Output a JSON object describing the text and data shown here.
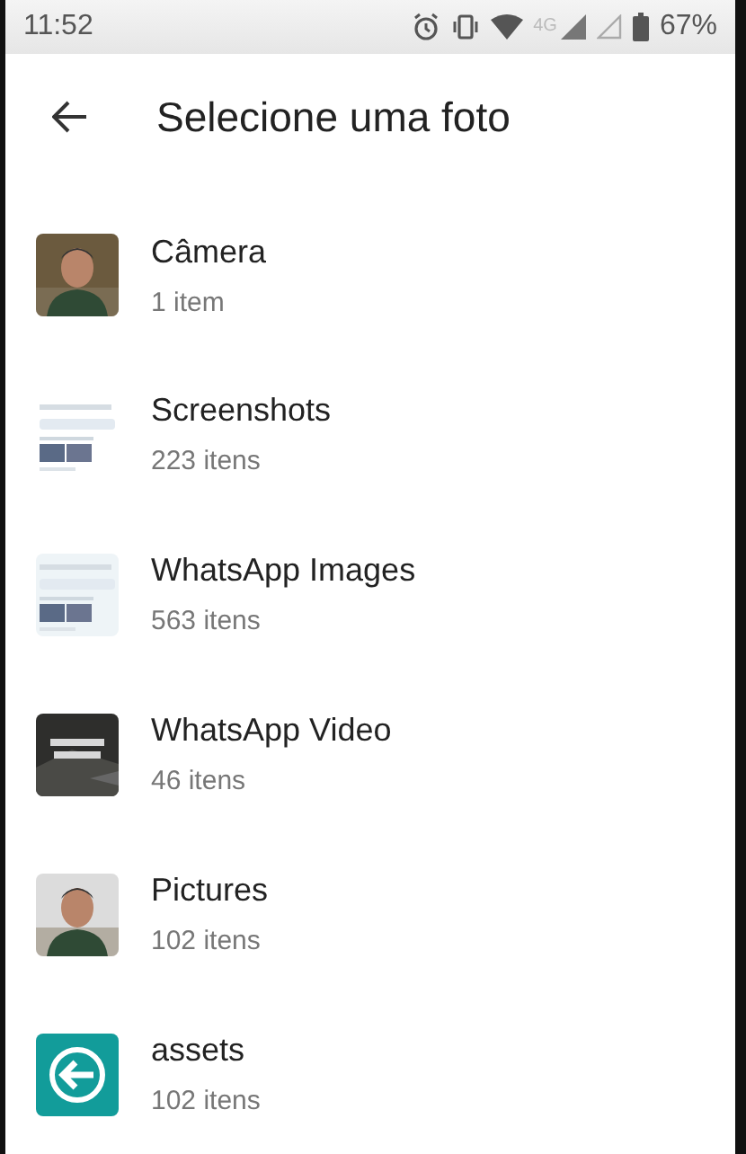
{
  "status_bar": {
    "time": "11:52",
    "network": "4G",
    "battery": "67%"
  },
  "app_bar": {
    "title": "Selecione uma foto"
  },
  "albums": [
    {
      "name": "Câmera",
      "count": "1 item",
      "thumb": {
        "kind": "person",
        "color": "#6b5a3e"
      }
    },
    {
      "name": "Screenshots",
      "count": "223 itens",
      "thumb": {
        "kind": "document",
        "color": "#ffffff"
      }
    },
    {
      "name": "WhatsApp Images",
      "count": "563 itens",
      "thumb": {
        "kind": "document",
        "color": "#eef4f7"
      }
    },
    {
      "name": "WhatsApp Video",
      "count": "46 itens",
      "thumb": {
        "kind": "dark",
        "color": "#2e2e2c"
      }
    },
    {
      "name": "Pictures",
      "count": "102 itens",
      "thumb": {
        "kind": "person",
        "color": "#dcdcdc"
      }
    },
    {
      "name": "assets",
      "count": "102 itens",
      "thumb": {
        "kind": "arrow",
        "color": "#129c9a"
      }
    }
  ]
}
